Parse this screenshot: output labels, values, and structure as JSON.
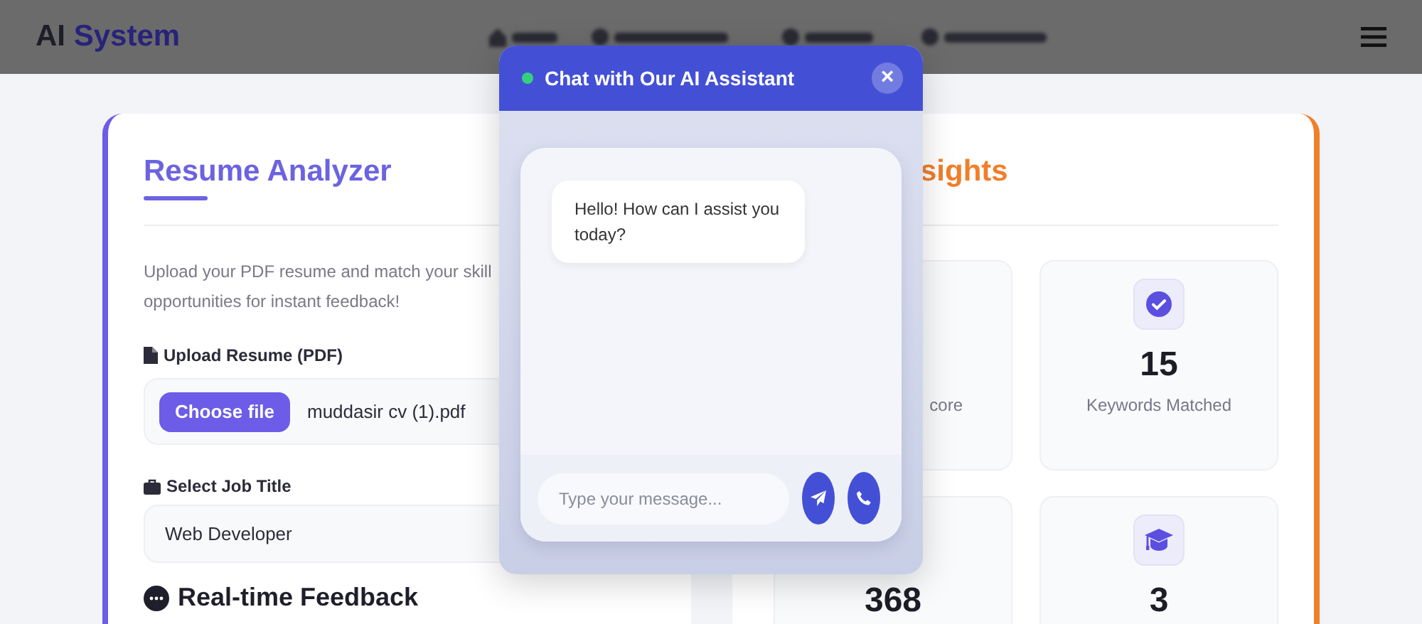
{
  "navbar": {
    "logo_prefix": "AI",
    "logo_suffix": "System"
  },
  "analyzer": {
    "title": "Resume Analyzer",
    "description_lines": [
      "Upload your PDF resume and match your skill",
      "opportunities for instant feedback!"
    ],
    "upload_label": "Upload Resume (PDF)",
    "choose_button": "Choose file",
    "file_name": "muddasir cv (1).pdf",
    "job_label": "Select Job Title",
    "job_value": "Web Developer",
    "feedback_title": "Real-time Feedback"
  },
  "insights": {
    "title": "sights",
    "stats": [
      {
        "label": "core"
      },
      {
        "value": "15",
        "label": "Keywords Matched"
      },
      {
        "value": "368"
      },
      {
        "value": "3"
      }
    ]
  },
  "chat": {
    "title": "Chat with Our AI Assistant",
    "online": true,
    "close": "×",
    "messages": [
      {
        "text": "Hello! How can I assist you today?"
      }
    ],
    "input": {
      "placeholder": "Type your message..."
    }
  }
}
